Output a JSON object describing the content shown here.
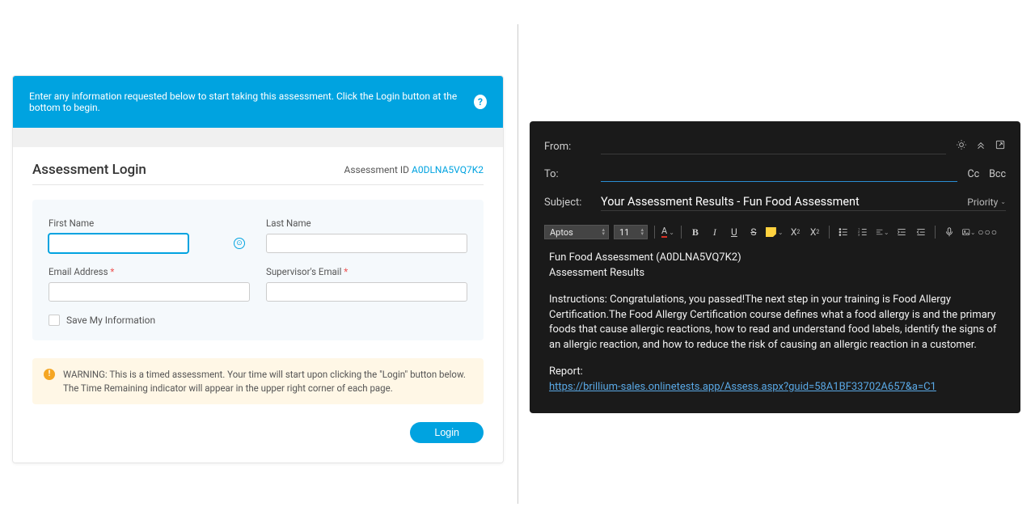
{
  "left": {
    "banner_text": "Enter any information requested below to start taking this assessment. Click the Login button at the bottom to begin.",
    "title": "Assessment Login",
    "assessment_id_label": "Assessment ID ",
    "assessment_id_value": "A0DLNA5VQ7K2",
    "fields": {
      "first_name": "First Name",
      "last_name": "Last Name",
      "email": "Email Address ",
      "supervisor_email": "Supervisor's Email "
    },
    "save_label": "Save My Information",
    "warning_text": "WARNING: This is a timed assessment. Your time will start upon clicking the \"Login\" button below. The Time Remaining indicator will appear in the upper right corner of each page.",
    "login_label": "Login"
  },
  "right": {
    "from_label": "From:",
    "to_label": "To:",
    "cc_label": "Cc",
    "bcc_label": "Bcc",
    "subject_label": "Subject:",
    "subject_value": "Your Assessment Results - Fun Food Assessment",
    "priority_label": "Priority",
    "font_name": "Aptos",
    "font_size": "11",
    "body": {
      "line1": "Fun Food Assessment (A0DLNA5VQ7K2)",
      "line2": "Assessment Results",
      "instructions": "Instructions: Congratulations, you passed!The next step in your training is Food Allergy Certification.The Food Allergy Certification course defines what a food allergy is and the primary foods that cause allergic reactions, how to read and understand food labels, identify the signs of an allergic reaction, and how to reduce the risk of causing an allergic reaction in a customer.",
      "report_label": "Report:",
      "report_link": "https://brillium-sales.onlinetests.app/Assess.aspx?guid=58A1BF33702A657&a=C1"
    }
  }
}
